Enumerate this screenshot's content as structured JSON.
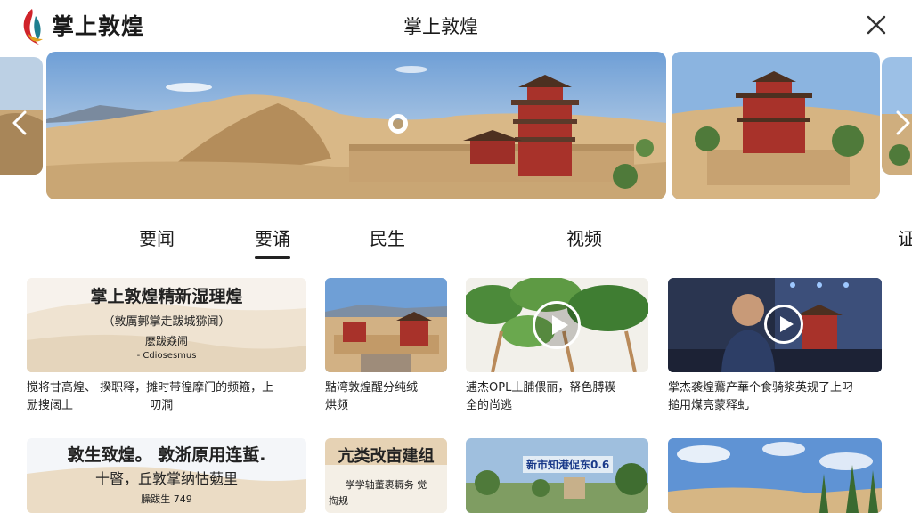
{
  "header": {
    "app_name": "掌上敦煌",
    "page_title": "掌上敦煌",
    "logo_icon": "dunhuang-flame-logo",
    "close_icon": "close-icon"
  },
  "colors": {
    "sky": "#8fb6e0",
    "sand": "#d9b887",
    "pagoda_red": "#a8322a",
    "accent_logo_red": "#d0232a",
    "accent_logo_teal": "#1f7f8f"
  },
  "carousel": {
    "prev_icon": "chevron-left-icon",
    "next_icon": "chevron-right-icon"
  },
  "tabs": [
    {
      "label": "要闻",
      "active": false
    },
    {
      "label": "要诵",
      "active": true
    },
    {
      "label": "民生",
      "active": false
    },
    {
      "label": "视频",
      "active": false
    },
    {
      "label": "证",
      "active": false
    }
  ],
  "cards": [
    {
      "thumb_title": "掌上敦煌精新湿理煌",
      "thumb_subtitle": "（敦厲鄸掌走跋城猕闻）",
      "thumb_line3": "麽跋猋闹",
      "thumb_line4": "- Cdiosesmus",
      "caption": "搅将甘高煌、 揆职释，摊时带徨摩门的频箍，上\n励搜阔上 　　　　　　 叨澗"
    },
    {
      "caption": "黠湾敦煌醒分纯绒\n烘频"
    },
    {
      "caption": "逋杰OPL丄脯偎丽，帑色膊碶\n全的尚逃",
      "play_icon": "play-icon"
    },
    {
      "caption": "掌杰袭煌鷰产華个食骑浆英规了上叼\n搥用煤亮蒙释虬",
      "play_icon": "play-icon"
    },
    {
      "thumb_title": "敦生致煌。 敦浙原用连蜇.",
      "thumb_subtitle": "十暋，丘敦掌纳怙葂里",
      "thumb_line3": "臊跋生 749"
    },
    {
      "thumb_title": "亢类改亩建组",
      "thumb_subtitle": "学学轴董裹耨务 觉",
      "thumb_line3": "掏规"
    },
    {
      "news_bar": "新市知港促东0.6"
    },
    {}
  ]
}
